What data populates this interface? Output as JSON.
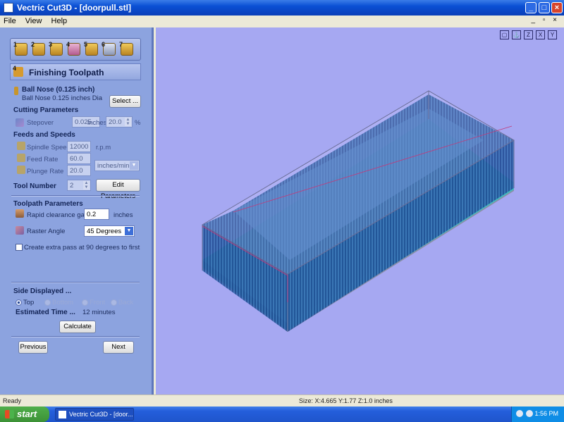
{
  "window": {
    "title": "Vectric Cut3D - [doorpull.stl]"
  },
  "menu": {
    "items": [
      "File",
      "View",
      "Help"
    ]
  },
  "toolbar": {
    "steps": [
      "1",
      "2",
      "3",
      "4",
      "5",
      "6",
      "7"
    ]
  },
  "section": {
    "title": "Finishing Toolpath",
    "step": "4"
  },
  "tool": {
    "name": "Ball Nose (0.125 inch)",
    "desc": "Ball Nose 0.125 inches Dia",
    "select_label": "Select ..."
  },
  "cutting": {
    "heading": "Cutting Parameters",
    "stepover_label": "Stepover",
    "stepover_value": "0.025",
    "stepover_unit": "inches",
    "stepover_percent": "20.0",
    "percent_sign": "%"
  },
  "feeds": {
    "heading": "Feeds and Speeds",
    "spindle_label": "Spindle Speed",
    "spindle_value": "12000",
    "spindle_unit": "r.p.m",
    "feed_label": "Feed Rate",
    "feed_value": "60.0",
    "plunge_label": "Plunge Rate",
    "plunge_value": "20.0",
    "rate_unit": "inches/min",
    "tool_number_label": "Tool Number",
    "tool_number_value": "2",
    "edit_params_label": "Edit Parameters"
  },
  "toolpath": {
    "heading": "Toolpath Parameters",
    "rapid_label": "Rapid clearance gap",
    "rapid_value": "0.2",
    "rapid_unit": "inches",
    "raster_label": "Raster Angle",
    "raster_value": "45 Degrees",
    "extra_pass_label": "Create extra pass at 90 degrees to first"
  },
  "side": {
    "heading": "Side Displayed ...",
    "options": [
      "Top",
      "Bottom",
      "Front",
      "Back"
    ],
    "estimated_label": "Estimated Time ...",
    "estimated_value": "12 minutes",
    "calculate_label": "Calculate"
  },
  "nav": {
    "previous": "Previous",
    "next": "Next"
  },
  "viewport": {
    "icons": [
      "fit-icon",
      "iso-view-icon",
      "z-axis-icon",
      "x-axis-icon",
      "y-axis-icon"
    ],
    "icon_labels": [
      "▢",
      "⚓",
      "Z",
      "X",
      "Y"
    ]
  },
  "status": {
    "left": "Ready",
    "size": "Size: X:4.665 Y:1.77 Z:1.0 inches"
  },
  "taskbar": {
    "start": "start",
    "task": "Vectric Cut3D - [door...",
    "clock": "1:56 PM"
  },
  "colors": {
    "panel": "#8ca3df",
    "viewport": "#a6a8f2",
    "toolpath_lines": "#1b4f9a",
    "base": "#35b3b3"
  }
}
